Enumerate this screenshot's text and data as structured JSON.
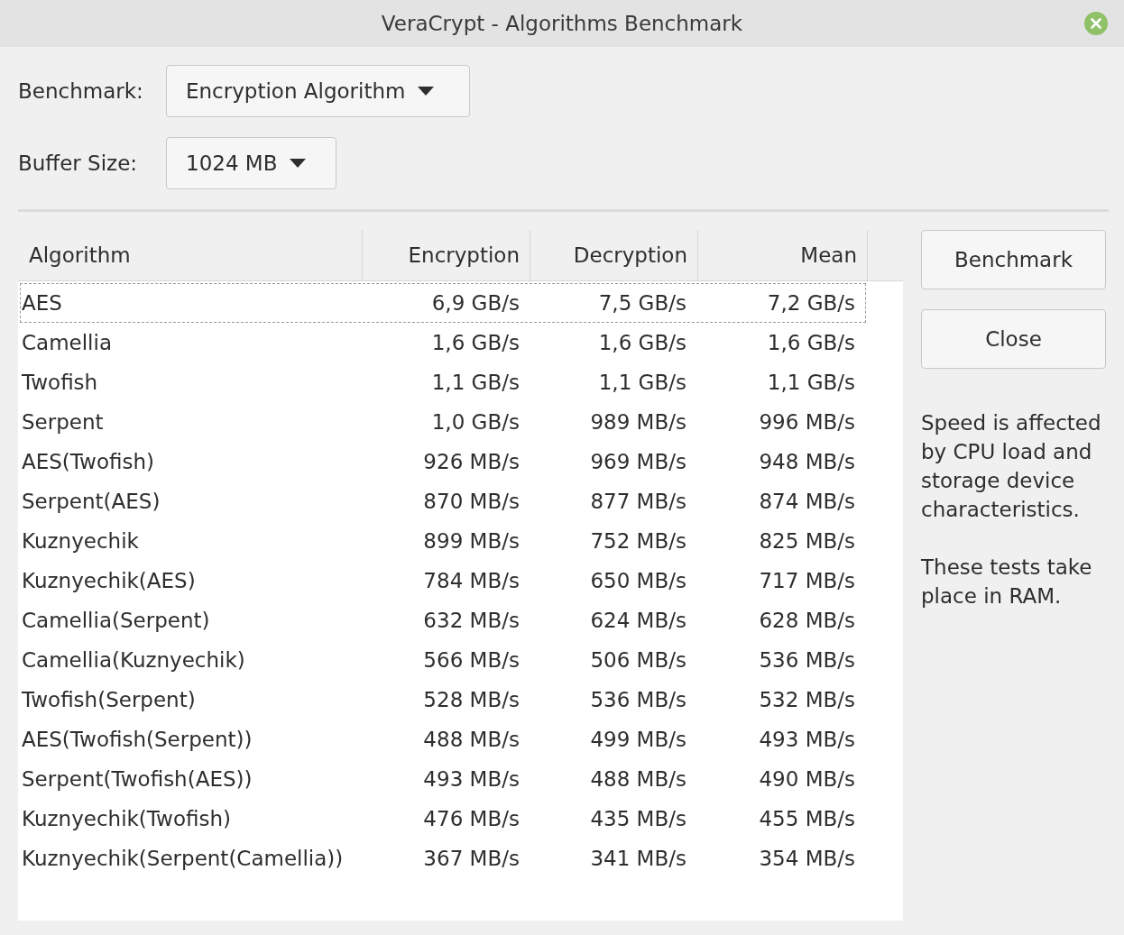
{
  "window": {
    "title": "VeraCrypt - Algorithms Benchmark"
  },
  "benchmark": {
    "label": "Benchmark:",
    "value": "Encryption Algorithm"
  },
  "buffer_size": {
    "label": "Buffer Size:",
    "value": "1024 MB"
  },
  "table": {
    "columns": [
      "Algorithm",
      "Encryption",
      "Decryption",
      "Mean"
    ],
    "rows": [
      {
        "cells": [
          "AES",
          "6,9 GB/s",
          "7,5 GB/s",
          "7,2 GB/s"
        ],
        "selected": true
      },
      {
        "cells": [
          "Camellia",
          "1,6 GB/s",
          "1,6 GB/s",
          "1,6 GB/s"
        ],
        "selected": false
      },
      {
        "cells": [
          "Twofish",
          "1,1 GB/s",
          "1,1 GB/s",
          "1,1 GB/s"
        ],
        "selected": false
      },
      {
        "cells": [
          "Serpent",
          "1,0 GB/s",
          "989 MB/s",
          "996 MB/s"
        ],
        "selected": false
      },
      {
        "cells": [
          "AES(Twofish)",
          "926 MB/s",
          "969 MB/s",
          "948 MB/s"
        ],
        "selected": false
      },
      {
        "cells": [
          "Serpent(AES)",
          "870 MB/s",
          "877 MB/s",
          "874 MB/s"
        ],
        "selected": false
      },
      {
        "cells": [
          "Kuznyechik",
          "899 MB/s",
          "752 MB/s",
          "825 MB/s"
        ],
        "selected": false
      },
      {
        "cells": [
          "Kuznyechik(AES)",
          "784 MB/s",
          "650 MB/s",
          "717 MB/s"
        ],
        "selected": false
      },
      {
        "cells": [
          "Camellia(Serpent)",
          "632 MB/s",
          "624 MB/s",
          "628 MB/s"
        ],
        "selected": false
      },
      {
        "cells": [
          "Camellia(Kuznyechik)",
          "566 MB/s",
          "506 MB/s",
          "536 MB/s"
        ],
        "selected": false
      },
      {
        "cells": [
          "Twofish(Serpent)",
          "528 MB/s",
          "536 MB/s",
          "532 MB/s"
        ],
        "selected": false
      },
      {
        "cells": [
          "AES(Twofish(Serpent))",
          "488 MB/s",
          "499 MB/s",
          "493 MB/s"
        ],
        "selected": false
      },
      {
        "cells": [
          "Serpent(Twofish(AES))",
          "493 MB/s",
          "488 MB/s",
          "490 MB/s"
        ],
        "selected": false
      },
      {
        "cells": [
          "Kuznyechik(Twofish)",
          "476 MB/s",
          "435 MB/s",
          "455 MB/s"
        ],
        "selected": false
      },
      {
        "cells": [
          "Kuznyechik(Serpent(Camellia))",
          "367 MB/s",
          "341 MB/s",
          "354 MB/s"
        ],
        "selected": false
      }
    ]
  },
  "buttons": [
    "Benchmark",
    "Close"
  ],
  "notes": [
    "Speed is affected by CPU load and storage device characteristics.",
    "These tests take place in RAM."
  ]
}
